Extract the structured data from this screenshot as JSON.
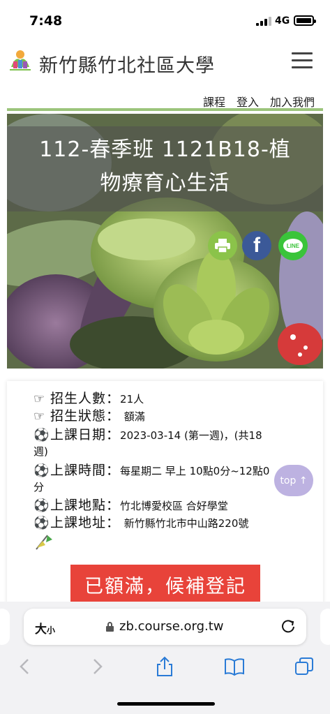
{
  "status_bar": {
    "time": "7:48",
    "network": "4G"
  },
  "header": {
    "site_title": "新竹縣竹北社區大學",
    "logo_caption": "竹北社區大學"
  },
  "nav": {
    "items": [
      "課程",
      "登入",
      "加入我們"
    ]
  },
  "hero": {
    "title_line1": "112-春季班 1121B18-植",
    "title_line2": "物療育心生活",
    "share_icons": [
      "print-icon",
      "facebook-icon",
      "line-icon"
    ],
    "line_text": "LINE",
    "fb_text": "f"
  },
  "course": {
    "enroll_count_label": "招生人數",
    "enroll_count_value": "21人",
    "enroll_status_label": "招生狀態",
    "enroll_status_value": "額滿",
    "class_date_label": "上課日期",
    "class_date_value": "2023-03-14 (第一週)，(共18",
    "class_date_wrap": "週)",
    "class_time_label": "上課時間",
    "class_time_value": "每星期二 早上 10點0分~12點0",
    "class_time_wrap": "分",
    "location_label": "上課地點",
    "location_value": "竹北博愛校區 合好學堂",
    "address_label": "上課地址",
    "address_value": "新竹縣竹北市中山路220號",
    "colon": "："
  },
  "actions": {
    "waitlist_label": "已額滿，候補登記",
    "top_label": "top ↑"
  },
  "browser": {
    "text_size_label": "大",
    "text_size_small": "小",
    "url": "zb.course.org.tw"
  },
  "colors": {
    "accent_green": "#9bc47b",
    "waitlist_red": "#e8433a",
    "top_button": "#b2a4dc"
  }
}
